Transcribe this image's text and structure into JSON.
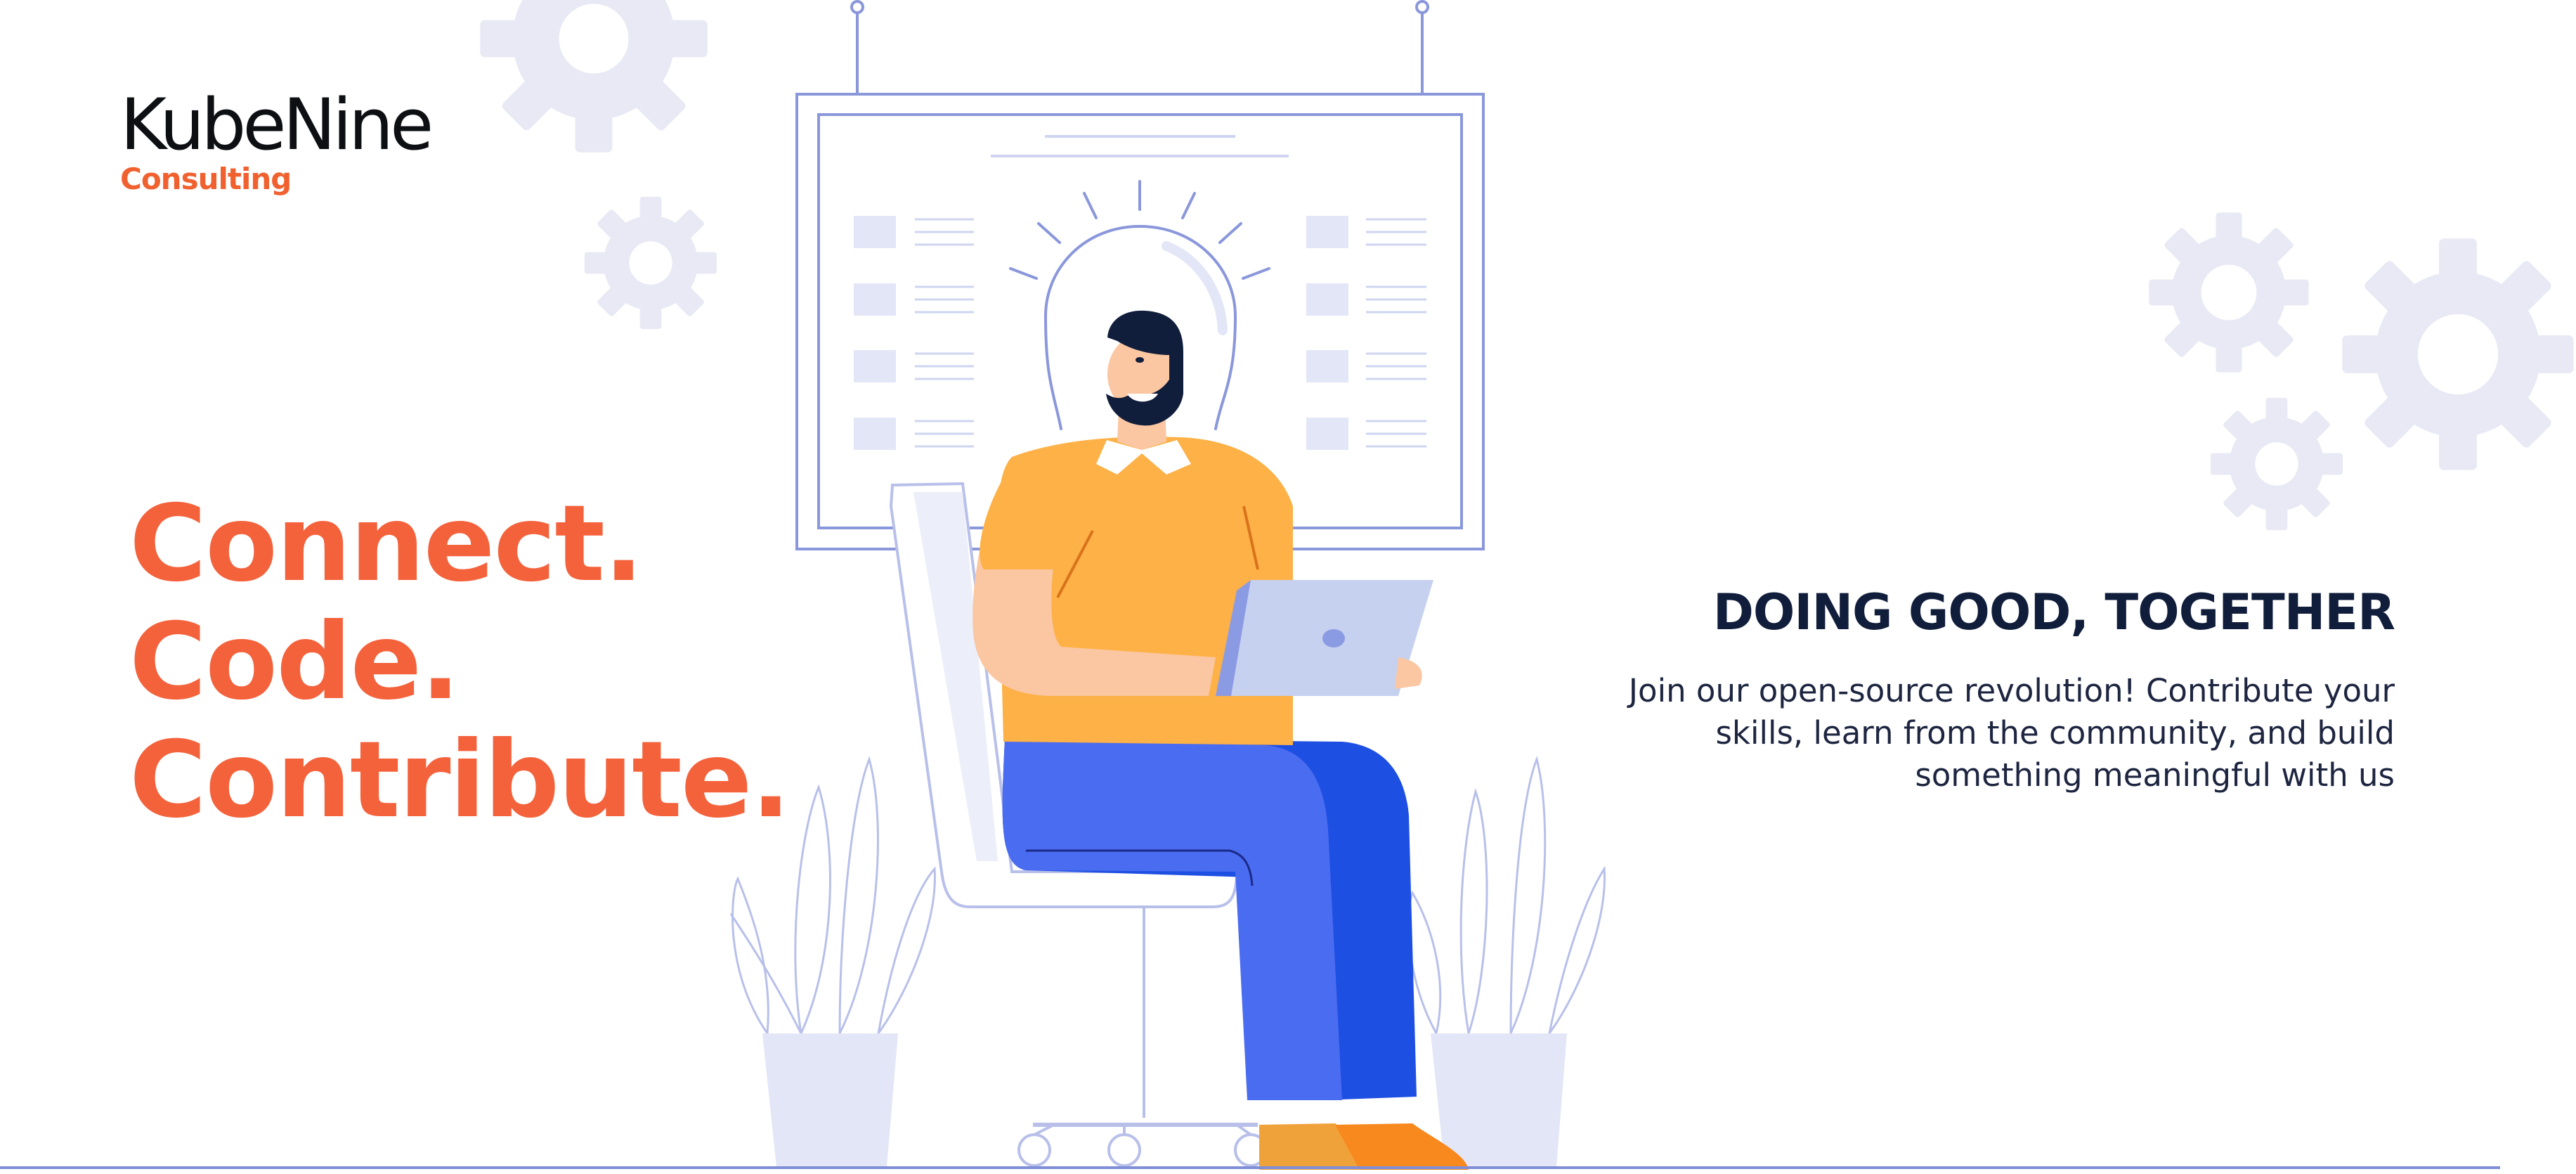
{
  "brand": {
    "name": "KubeNine",
    "tagline": "Consulting"
  },
  "hero": {
    "headline_lines": [
      "Connect.",
      "Code.",
      "Contribute."
    ]
  },
  "mission": {
    "title": "DOING GOOD, TOGETHER",
    "description_lines": [
      "Join our open-source revolution! Contribute your",
      "skills, learn from the community, and build",
      "something meaningful with us"
    ]
  },
  "colors": {
    "accent": "#f4623c",
    "heading": "#111e3b",
    "gear": "#e8e9f4",
    "line": "#8a97db",
    "shirt": "#fdb146",
    "jeans": "#4867ec",
    "laptop": "#c6d0ef"
  },
  "illustration": {
    "subject": "developer-on-chair-with-laptop",
    "icons": [
      "gear-icon",
      "lightbulb-icon",
      "plant-icon",
      "laptop-icon",
      "whiteboard-icon"
    ]
  }
}
